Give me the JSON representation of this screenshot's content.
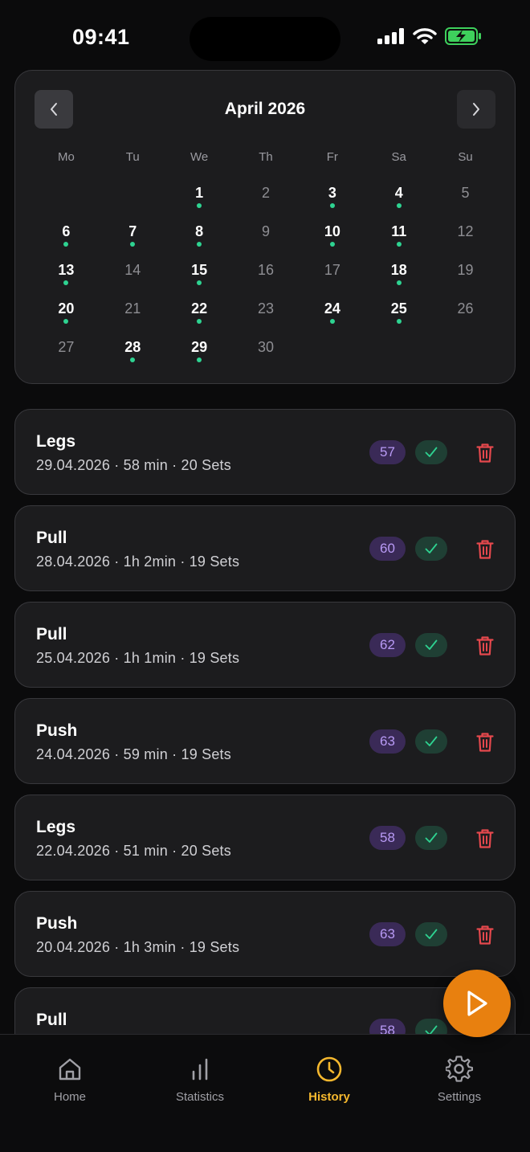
{
  "status_bar": {
    "time": "09:41"
  },
  "calendar": {
    "month_title": "April 2026",
    "weekdays": [
      "Mo",
      "Tu",
      "We",
      "Th",
      "Fr",
      "Sa",
      "Su"
    ],
    "leading_blanks": 2,
    "days": [
      {
        "d": "1",
        "workout": true
      },
      {
        "d": "2",
        "workout": false
      },
      {
        "d": "3",
        "workout": true
      },
      {
        "d": "4",
        "workout": true
      },
      {
        "d": "5",
        "workout": false
      },
      {
        "d": "6",
        "workout": true
      },
      {
        "d": "7",
        "workout": true
      },
      {
        "d": "8",
        "workout": true
      },
      {
        "d": "9",
        "workout": false
      },
      {
        "d": "10",
        "workout": true
      },
      {
        "d": "11",
        "workout": true
      },
      {
        "d": "12",
        "workout": false
      },
      {
        "d": "13",
        "workout": true
      },
      {
        "d": "14",
        "workout": false
      },
      {
        "d": "15",
        "workout": true
      },
      {
        "d": "16",
        "workout": false
      },
      {
        "d": "17",
        "workout": false
      },
      {
        "d": "18",
        "workout": true
      },
      {
        "d": "19",
        "workout": false
      },
      {
        "d": "20",
        "workout": true
      },
      {
        "d": "21",
        "workout": false
      },
      {
        "d": "22",
        "workout": true
      },
      {
        "d": "23",
        "workout": false
      },
      {
        "d": "24",
        "workout": true
      },
      {
        "d": "25",
        "workout": true
      },
      {
        "d": "26",
        "workout": false
      },
      {
        "d": "27",
        "workout": false
      },
      {
        "d": "28",
        "workout": true
      },
      {
        "d": "29",
        "workout": true
      },
      {
        "d": "30",
        "workout": false
      }
    ]
  },
  "workouts": [
    {
      "name": "Legs",
      "meta": "29.04.2026 · 58 min · 20 Sets",
      "score": "57",
      "completed": true
    },
    {
      "name": "Pull",
      "meta": "28.04.2026 · 1h 2min · 19 Sets",
      "score": "60",
      "completed": true
    },
    {
      "name": "Pull",
      "meta": "25.04.2026 · 1h 1min · 19 Sets",
      "score": "62",
      "completed": true
    },
    {
      "name": "Push",
      "meta": "24.04.2026 · 59 min · 19 Sets",
      "score": "63",
      "completed": true
    },
    {
      "name": "Legs",
      "meta": "22.04.2026 · 51 min · 20 Sets",
      "score": "58",
      "completed": true
    },
    {
      "name": "Push",
      "meta": "20.04.2026 · 1h 3min · 19 Sets",
      "score": "63",
      "completed": true
    },
    {
      "name": "Pull",
      "meta": "",
      "score": "58",
      "completed": true
    }
  ],
  "tab_bar": {
    "tabs": [
      {
        "label": "Home",
        "icon": "home-icon",
        "selected": false
      },
      {
        "label": "Statistics",
        "icon": "bar-chart-icon",
        "selected": false
      },
      {
        "label": "History",
        "icon": "clock-icon",
        "selected": true
      },
      {
        "label": "Settings",
        "icon": "gear-icon",
        "selected": false
      }
    ]
  },
  "colors": {
    "accent_orange": "#e8800f",
    "active_tab": "#f5b82e",
    "workout_dot": "#2ed391",
    "score_badge": "#b89af5",
    "delete_red": "#e5484d"
  }
}
